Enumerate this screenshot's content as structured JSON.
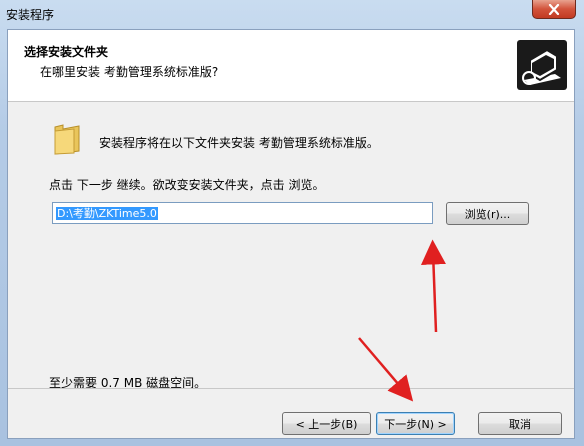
{
  "window": {
    "title": "安装程序"
  },
  "header": {
    "title": "选择安装文件夹",
    "subtitle": "在哪里安装 考勤管理系统标准版?"
  },
  "body": {
    "install_text": "安装程序将在以下文件夹安装 考勤管理系统标准版。",
    "instruction_text": "点击 下一步 继续。欲改变安装文件夹，点击 浏览。",
    "path_value": "D:\\考勤\\ZKTime5.0",
    "browse_label": "浏览(r)...",
    "disk_space_text": "至少需要 0.7 MB 磁盘空间。"
  },
  "footer": {
    "back_label": "< 上一步(B)",
    "next_label": "下一步(N) >",
    "cancel_label": "取消"
  },
  "colors": {
    "accent_arrow": "#e02020",
    "selection": "#3399ff"
  },
  "icons": [
    "close-icon",
    "folder-icon",
    "setup-logo-icon"
  ]
}
